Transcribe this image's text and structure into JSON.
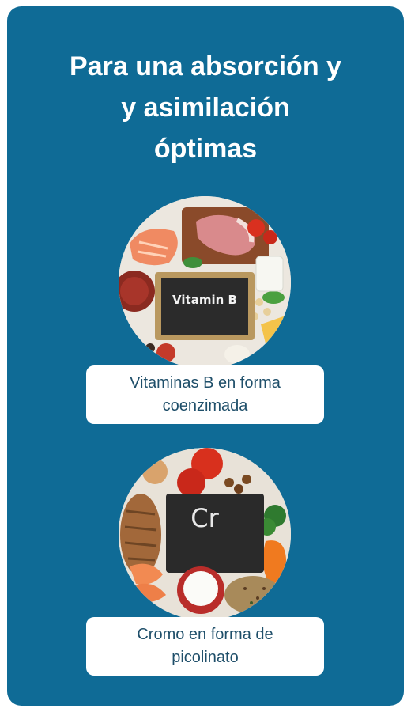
{
  "title": {
    "line1": "Para una absorción y",
    "line2": "y asimilación",
    "line3": "óptimas"
  },
  "items": [
    {
      "image_icon": "vitamin-b-foods-image",
      "board_text": "Vitamin B",
      "label_line1": "Vitaminas B en forma",
      "label_line2": "coenzimada"
    },
    {
      "image_icon": "chromium-foods-image",
      "board_text": "Cr",
      "label_line1": "Cromo en forma de",
      "label_line2": "picolinato"
    }
  ],
  "colors": {
    "background": "#0f6b96",
    "label_bg": "#ffffff",
    "label_text": "#1f4f6a",
    "title_text": "#ffffff"
  }
}
